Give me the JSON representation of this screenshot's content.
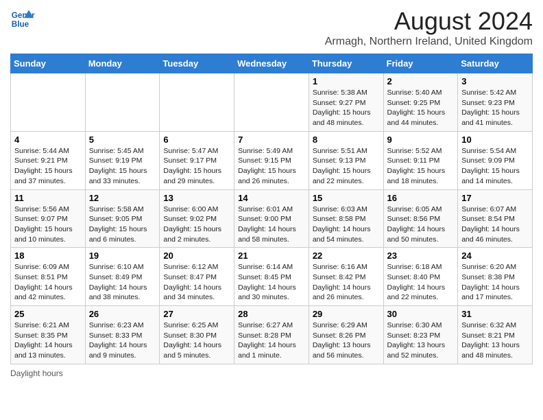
{
  "header": {
    "logo_line1": "General",
    "logo_line2": "Blue",
    "title": "August 2024",
    "subtitle": "Armagh, Northern Ireland, United Kingdom"
  },
  "calendar": {
    "days_of_week": [
      "Sunday",
      "Monday",
      "Tuesday",
      "Wednesday",
      "Thursday",
      "Friday",
      "Saturday"
    ],
    "weeks": [
      [
        {
          "day": "",
          "info": ""
        },
        {
          "day": "",
          "info": ""
        },
        {
          "day": "",
          "info": ""
        },
        {
          "day": "",
          "info": ""
        },
        {
          "day": "1",
          "info": "Sunrise: 5:38 AM\nSunset: 9:27 PM\nDaylight: 15 hours\nand 48 minutes."
        },
        {
          "day": "2",
          "info": "Sunrise: 5:40 AM\nSunset: 9:25 PM\nDaylight: 15 hours\nand 44 minutes."
        },
        {
          "day": "3",
          "info": "Sunrise: 5:42 AM\nSunset: 9:23 PM\nDaylight: 15 hours\nand 41 minutes."
        }
      ],
      [
        {
          "day": "4",
          "info": "Sunrise: 5:44 AM\nSunset: 9:21 PM\nDaylight: 15 hours\nand 37 minutes."
        },
        {
          "day": "5",
          "info": "Sunrise: 5:45 AM\nSunset: 9:19 PM\nDaylight: 15 hours\nand 33 minutes."
        },
        {
          "day": "6",
          "info": "Sunrise: 5:47 AM\nSunset: 9:17 PM\nDaylight: 15 hours\nand 29 minutes."
        },
        {
          "day": "7",
          "info": "Sunrise: 5:49 AM\nSunset: 9:15 PM\nDaylight: 15 hours\nand 26 minutes."
        },
        {
          "day": "8",
          "info": "Sunrise: 5:51 AM\nSunset: 9:13 PM\nDaylight: 15 hours\nand 22 minutes."
        },
        {
          "day": "9",
          "info": "Sunrise: 5:52 AM\nSunset: 9:11 PM\nDaylight: 15 hours\nand 18 minutes."
        },
        {
          "day": "10",
          "info": "Sunrise: 5:54 AM\nSunset: 9:09 PM\nDaylight: 15 hours\nand 14 minutes."
        }
      ],
      [
        {
          "day": "11",
          "info": "Sunrise: 5:56 AM\nSunset: 9:07 PM\nDaylight: 15 hours\nand 10 minutes."
        },
        {
          "day": "12",
          "info": "Sunrise: 5:58 AM\nSunset: 9:05 PM\nDaylight: 15 hours\nand 6 minutes."
        },
        {
          "day": "13",
          "info": "Sunrise: 6:00 AM\nSunset: 9:02 PM\nDaylight: 15 hours\nand 2 minutes."
        },
        {
          "day": "14",
          "info": "Sunrise: 6:01 AM\nSunset: 9:00 PM\nDaylight: 14 hours\nand 58 minutes."
        },
        {
          "day": "15",
          "info": "Sunrise: 6:03 AM\nSunset: 8:58 PM\nDaylight: 14 hours\nand 54 minutes."
        },
        {
          "day": "16",
          "info": "Sunrise: 6:05 AM\nSunset: 8:56 PM\nDaylight: 14 hours\nand 50 minutes."
        },
        {
          "day": "17",
          "info": "Sunrise: 6:07 AM\nSunset: 8:54 PM\nDaylight: 14 hours\nand 46 minutes."
        }
      ],
      [
        {
          "day": "18",
          "info": "Sunrise: 6:09 AM\nSunset: 8:51 PM\nDaylight: 14 hours\nand 42 minutes."
        },
        {
          "day": "19",
          "info": "Sunrise: 6:10 AM\nSunset: 8:49 PM\nDaylight: 14 hours\nand 38 minutes."
        },
        {
          "day": "20",
          "info": "Sunrise: 6:12 AM\nSunset: 8:47 PM\nDaylight: 14 hours\nand 34 minutes."
        },
        {
          "day": "21",
          "info": "Sunrise: 6:14 AM\nSunset: 8:45 PM\nDaylight: 14 hours\nand 30 minutes."
        },
        {
          "day": "22",
          "info": "Sunrise: 6:16 AM\nSunset: 8:42 PM\nDaylight: 14 hours\nand 26 minutes."
        },
        {
          "day": "23",
          "info": "Sunrise: 6:18 AM\nSunset: 8:40 PM\nDaylight: 14 hours\nand 22 minutes."
        },
        {
          "day": "24",
          "info": "Sunrise: 6:20 AM\nSunset: 8:38 PM\nDaylight: 14 hours\nand 17 minutes."
        }
      ],
      [
        {
          "day": "25",
          "info": "Sunrise: 6:21 AM\nSunset: 8:35 PM\nDaylight: 14 hours\nand 13 minutes."
        },
        {
          "day": "26",
          "info": "Sunrise: 6:23 AM\nSunset: 8:33 PM\nDaylight: 14 hours\nand 9 minutes."
        },
        {
          "day": "27",
          "info": "Sunrise: 6:25 AM\nSunset: 8:30 PM\nDaylight: 14 hours\nand 5 minutes."
        },
        {
          "day": "28",
          "info": "Sunrise: 6:27 AM\nSunset: 8:28 PM\nDaylight: 14 hours\nand 1 minute."
        },
        {
          "day": "29",
          "info": "Sunrise: 6:29 AM\nSunset: 8:26 PM\nDaylight: 13 hours\nand 56 minutes."
        },
        {
          "day": "30",
          "info": "Sunrise: 6:30 AM\nSunset: 8:23 PM\nDaylight: 13 hours\nand 52 minutes."
        },
        {
          "day": "31",
          "info": "Sunrise: 6:32 AM\nSunset: 8:21 PM\nDaylight: 13 hours\nand 48 minutes."
        }
      ]
    ]
  },
  "footer": {
    "note": "Daylight hours"
  }
}
